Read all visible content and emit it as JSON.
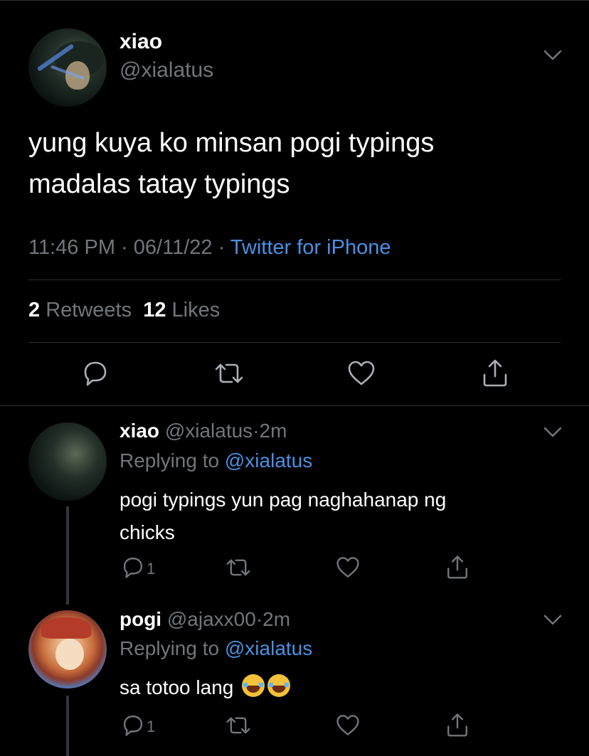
{
  "tweet": {
    "name": "xiao",
    "handle": "@xialatus",
    "text_line1": "yung kuya ko minsan pogi typings",
    "text_line2": "madalas tatay typings",
    "time": "11:46 PM",
    "date": "06/11/22",
    "source": "Twitter for iPhone",
    "retweets_count": "2",
    "retweets_label": "Retweets",
    "likes_count": "12",
    "likes_label": "Likes"
  },
  "replies": [
    {
      "name": "xiao",
      "handle": "@xialatus",
      "age": "2m",
      "replying_label": "Replying to",
      "replying_to": "@xialatus",
      "text_line1": "pogi typings yun pag naghahanap ng",
      "text_line2": "chicks",
      "reply_count": "1"
    },
    {
      "name": "pogi",
      "handle": "@ajaxx00",
      "age": "2m",
      "replying_label": "Replying to",
      "replying_to": "@xialatus",
      "text": "sa totoo lang",
      "emoji": [
        "joy",
        "joy"
      ],
      "reply_count": "1"
    }
  ],
  "separator": "·",
  "colors": {
    "background": "#000000",
    "text": "#ffffff",
    "muted": "#71767b",
    "link": "#4a90e2",
    "divider": "#2f3336"
  },
  "icons": [
    "chevron-down-icon",
    "reply-icon",
    "retweet-icon",
    "like-icon",
    "share-icon"
  ]
}
